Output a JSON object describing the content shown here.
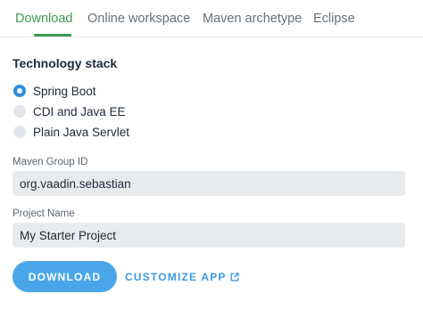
{
  "tabs": [
    {
      "label": "Download",
      "active": true
    },
    {
      "label": "Online workspace",
      "active": false
    },
    {
      "label": "Maven archetype",
      "active": false
    },
    {
      "label": "Eclipse",
      "active": false
    }
  ],
  "technology_stack": {
    "title": "Technology stack",
    "options": [
      {
        "label": "Spring Boot",
        "selected": true
      },
      {
        "label": "CDI and Java EE",
        "selected": false
      },
      {
        "label": "Plain Java Servlet",
        "selected": false
      }
    ]
  },
  "fields": {
    "group_id": {
      "label": "Maven Group ID",
      "value": "org.vaadin.sebastian"
    },
    "project_name": {
      "label": "Project Name",
      "value": "My Starter Project"
    }
  },
  "actions": {
    "download_label": "DOWNLOAD",
    "customize_label": "CUSTOMIZE APP",
    "customize_icon": "external-link-icon"
  },
  "colors": {
    "active_tab": "#3e9a51",
    "accent_blue": "#4aa6ea",
    "link_blue": "#3e9ae0",
    "field_bg": "#e8ebee"
  }
}
